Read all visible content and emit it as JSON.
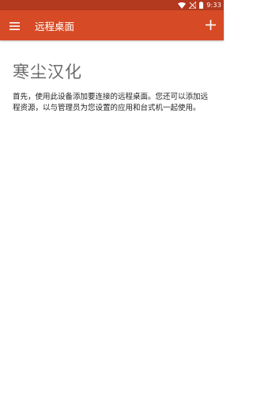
{
  "status_bar": {
    "time": "9:33",
    "icons": [
      "wifi-icon",
      "signal-off-icon",
      "battery-icon"
    ]
  },
  "app_bar": {
    "menu_icon": "hamburger-menu-icon",
    "title": "远程桌面",
    "add_icon": "plus-icon"
  },
  "main": {
    "heading": "寒尘汉化",
    "description": "首先，使用此设备添加要连接的远程桌面。您还可以添加远程资源，以与管理员为您设置的应用和台式机一起使用。"
  },
  "colors": {
    "status_bar": "#b3391f",
    "app_bar": "#d64b26",
    "background": "#ffffff",
    "heading_text": "#6b6b6b",
    "body_text": "#222222"
  }
}
